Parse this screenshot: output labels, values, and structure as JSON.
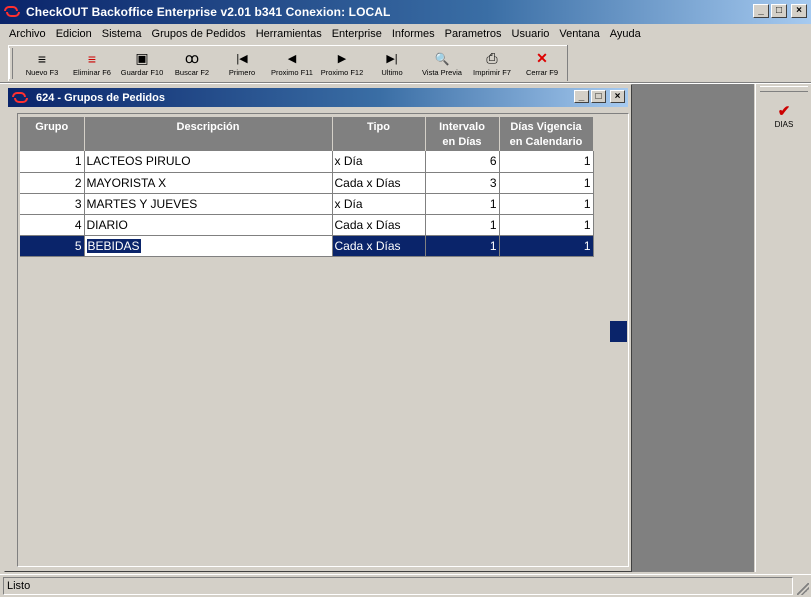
{
  "window": {
    "title": "CheckOUT Backoffice Enterprise v2.01 b341 Conexion: LOCAL",
    "min": "_",
    "max": "□",
    "close": "×"
  },
  "menu": [
    "Archivo",
    "Edicion",
    "Sistema",
    "Grupos de Pedidos",
    "Herramientas",
    "Enterprise",
    "Informes",
    "Parametros",
    "Usuario",
    "Ventana",
    "Ayuda"
  ],
  "toolbar": [
    {
      "label": "Nuevo F3",
      "icon": "new-icon",
      "glyph": "≡",
      "color": "#000000"
    },
    {
      "label": "Eliminar F6",
      "icon": "delete-record-icon",
      "glyph": "≡",
      "color": "#cc0000"
    },
    {
      "label": "Guardar F10",
      "icon": "save-icon",
      "glyph": "▣",
      "color": "#000000"
    },
    {
      "label": "Buscar F2",
      "icon": "binoculars-icon",
      "glyph": "ꝏ",
      "color": "#000000"
    },
    {
      "label": "Primero",
      "icon": "first-icon",
      "glyph": "|◀",
      "color": "#000000"
    },
    {
      "label": "Proximo F11",
      "icon": "previous-icon",
      "glyph": "◀",
      "color": "#000000"
    },
    {
      "label": "Proximo F12",
      "icon": "next-icon",
      "glyph": "▶",
      "color": "#000000"
    },
    {
      "label": "Ultimo",
      "icon": "last-icon",
      "glyph": "▶|",
      "color": "#000000"
    },
    {
      "label": "Vista Previa",
      "icon": "preview-icon",
      "glyph": "🔍",
      "color": "#2a6aa0"
    },
    {
      "label": "Imprimir F7",
      "icon": "printer-icon",
      "glyph": "⎙",
      "color": "#000000"
    },
    {
      "label": "Cerrar F9",
      "icon": "close-icon",
      "glyph": "✕",
      "color": "#dd0000"
    }
  ],
  "child": {
    "title": "624 - Grupos de Pedidos",
    "min": "_",
    "max": "□",
    "close": "×"
  },
  "grid": {
    "headers": [
      "Grupo",
      "Descripción",
      "Tipo",
      "Intervalo\nen Días",
      "Días Vigencia\nen Calendario"
    ],
    "rows": [
      {
        "grupo": "1",
        "descripcion": "LACTEOS PIRULO",
        "tipo": "x Día",
        "intervalo": "6",
        "vigencia": "1"
      },
      {
        "grupo": "2",
        "descripcion": "MAYORISTA X",
        "tipo": "Cada x Días",
        "intervalo": "3",
        "vigencia": "1"
      },
      {
        "grupo": "3",
        "descripcion": "MARTES Y JUEVES",
        "tipo": "x Día",
        "intervalo": "1",
        "vigencia": "1"
      },
      {
        "grupo": "4",
        "descripcion": "DIARIO",
        "tipo": "Cada x Días",
        "intervalo": "1",
        "vigencia": "1"
      },
      {
        "grupo": "5",
        "descripcion": "BEBIDAS",
        "tipo": "Cada x Días",
        "intervalo": "1",
        "vigencia": "1"
      }
    ],
    "selected_row": 5
  },
  "right_panel": {
    "button_label": "DIAS",
    "icon": "checkmark-icon",
    "glyph": "✔"
  },
  "status": {
    "text": "Listo"
  },
  "colors": {
    "title_bar": "#0a246a",
    "selection": "#0a246a",
    "header_bg": "#808080",
    "mdi_bg": "#808080"
  }
}
